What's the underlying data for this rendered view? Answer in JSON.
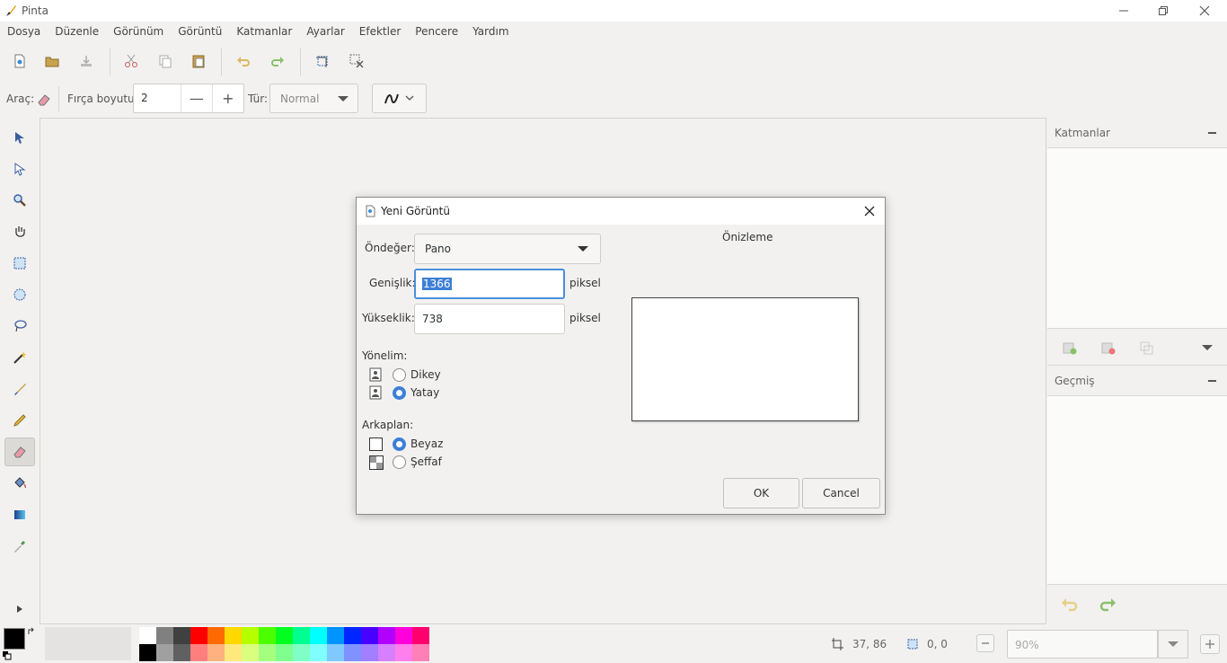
{
  "window": {
    "title": "Pinta"
  },
  "menu": [
    "Dosya",
    "Düzenle",
    "Görünüm",
    "Görüntü",
    "Katmanlar",
    "Ayarlar",
    "Efektler",
    "Pencere",
    "Yardım"
  ],
  "tool_options": {
    "tool_label": "Araç:",
    "brush_size_label": "Fırça boyutu:",
    "brush_size_value": "2",
    "type_label": "Tür:",
    "type_value": "Normal"
  },
  "panels": {
    "layers_title": "Katmanlar",
    "history_title": "Geçmiş"
  },
  "status": {
    "cursor_pos": "37, 86",
    "selection_size": "0, 0",
    "zoom": "90%"
  },
  "dialog": {
    "title": "Yeni Görüntü",
    "preset_label": "Öndeğer:",
    "preset_value": "Pano",
    "width_label": "Genişlik:",
    "width_value": "1366",
    "height_label": "Yükseklik:",
    "height_value": "738",
    "unit": "piksel",
    "orientation_label": "Yönelim:",
    "portrait_label": "Dikey",
    "landscape_label": "Yatay",
    "background_label": "Arkaplan:",
    "white_label": "Beyaz",
    "transparent_label": "Şeffaf",
    "preview_label": "Önizleme",
    "ok_label": "OK",
    "cancel_label": "Cancel"
  },
  "palette": {
    "top": [
      "#ffffff",
      "#808080",
      "#404040",
      "#ff0000",
      "#ff6a00",
      "#ffd800",
      "#b6ff00",
      "#4cff00",
      "#00ff21",
      "#00ff90",
      "#00ffff",
      "#0094ff",
      "#0026ff",
      "#4800ff",
      "#b200ff",
      "#ff00dc",
      "#ff006e"
    ],
    "bottom": [
      "#000000",
      "#a0a0a0",
      "#606060",
      "#ff7f7f",
      "#ffb27f",
      "#ffe97f",
      "#daff7f",
      "#a5ff7f",
      "#7fff8e",
      "#7fffc5",
      "#7fffff",
      "#7fc9ff",
      "#7f92ff",
      "#a17fff",
      "#d67fff",
      "#ff7fed",
      "#ff7fb6"
    ]
  }
}
